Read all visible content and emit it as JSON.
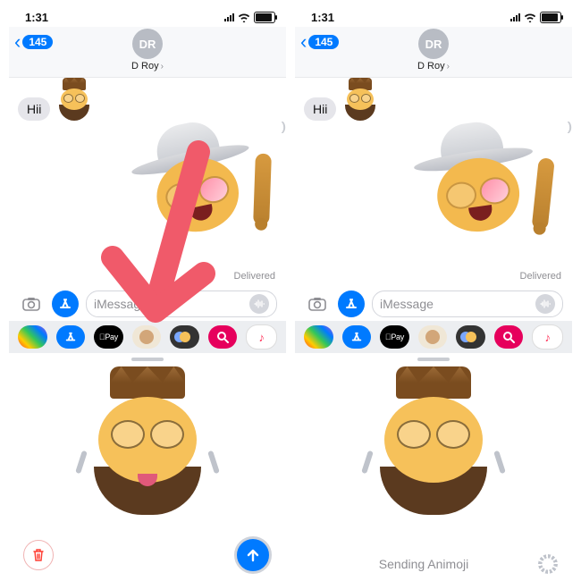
{
  "status": {
    "time": "1:31"
  },
  "nav": {
    "back_count": "145",
    "contact_initials": "DR",
    "contact_name": "D Roy"
  },
  "chat": {
    "incoming_text": "Hii",
    "delivered_label": "Delivered"
  },
  "input": {
    "placeholder": "iMessage"
  },
  "appstrip": {
    "applepay_label": "Pay"
  },
  "drawer": {
    "sending_label": "Sending Animoji"
  },
  "peek_memoji": {
    "left_variant": "crown-beard",
    "right_variant": "crown-beard"
  },
  "arrow_points_to": "animoji-app-button"
}
